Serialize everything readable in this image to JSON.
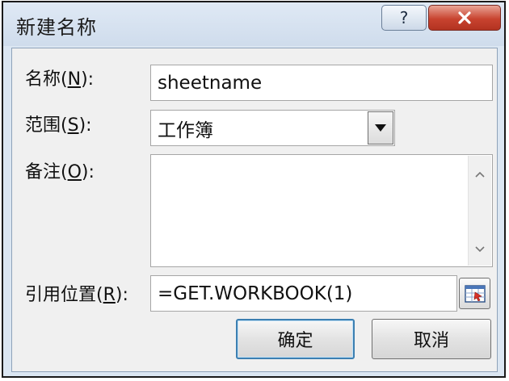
{
  "window": {
    "title": "新建名称",
    "help_label": "?",
    "close_label": "×"
  },
  "form": {
    "name": {
      "label": "名称(",
      "mnemonic": "N",
      "suffix": "):",
      "value": "sheetname"
    },
    "scope": {
      "label": "范围(",
      "mnemonic": "S",
      "suffix": "):",
      "value": "工作簿"
    },
    "comment": {
      "label": "备注(",
      "mnemonic": "O",
      "suffix": "):",
      "value": ""
    },
    "refers_to": {
      "label": "引用位置(",
      "mnemonic": "R",
      "suffix": "):",
      "value": "=GET.WORKBOOK(1)"
    }
  },
  "buttons": {
    "ok_label": "确定",
    "cancel_label": "取消"
  },
  "icons": {
    "dropdown": "chevron-down-icon",
    "scroll_up": "scroll-up-icon",
    "scroll_down": "scroll-down-icon",
    "collapse_dialog": "collapse-dialog-icon"
  }
}
